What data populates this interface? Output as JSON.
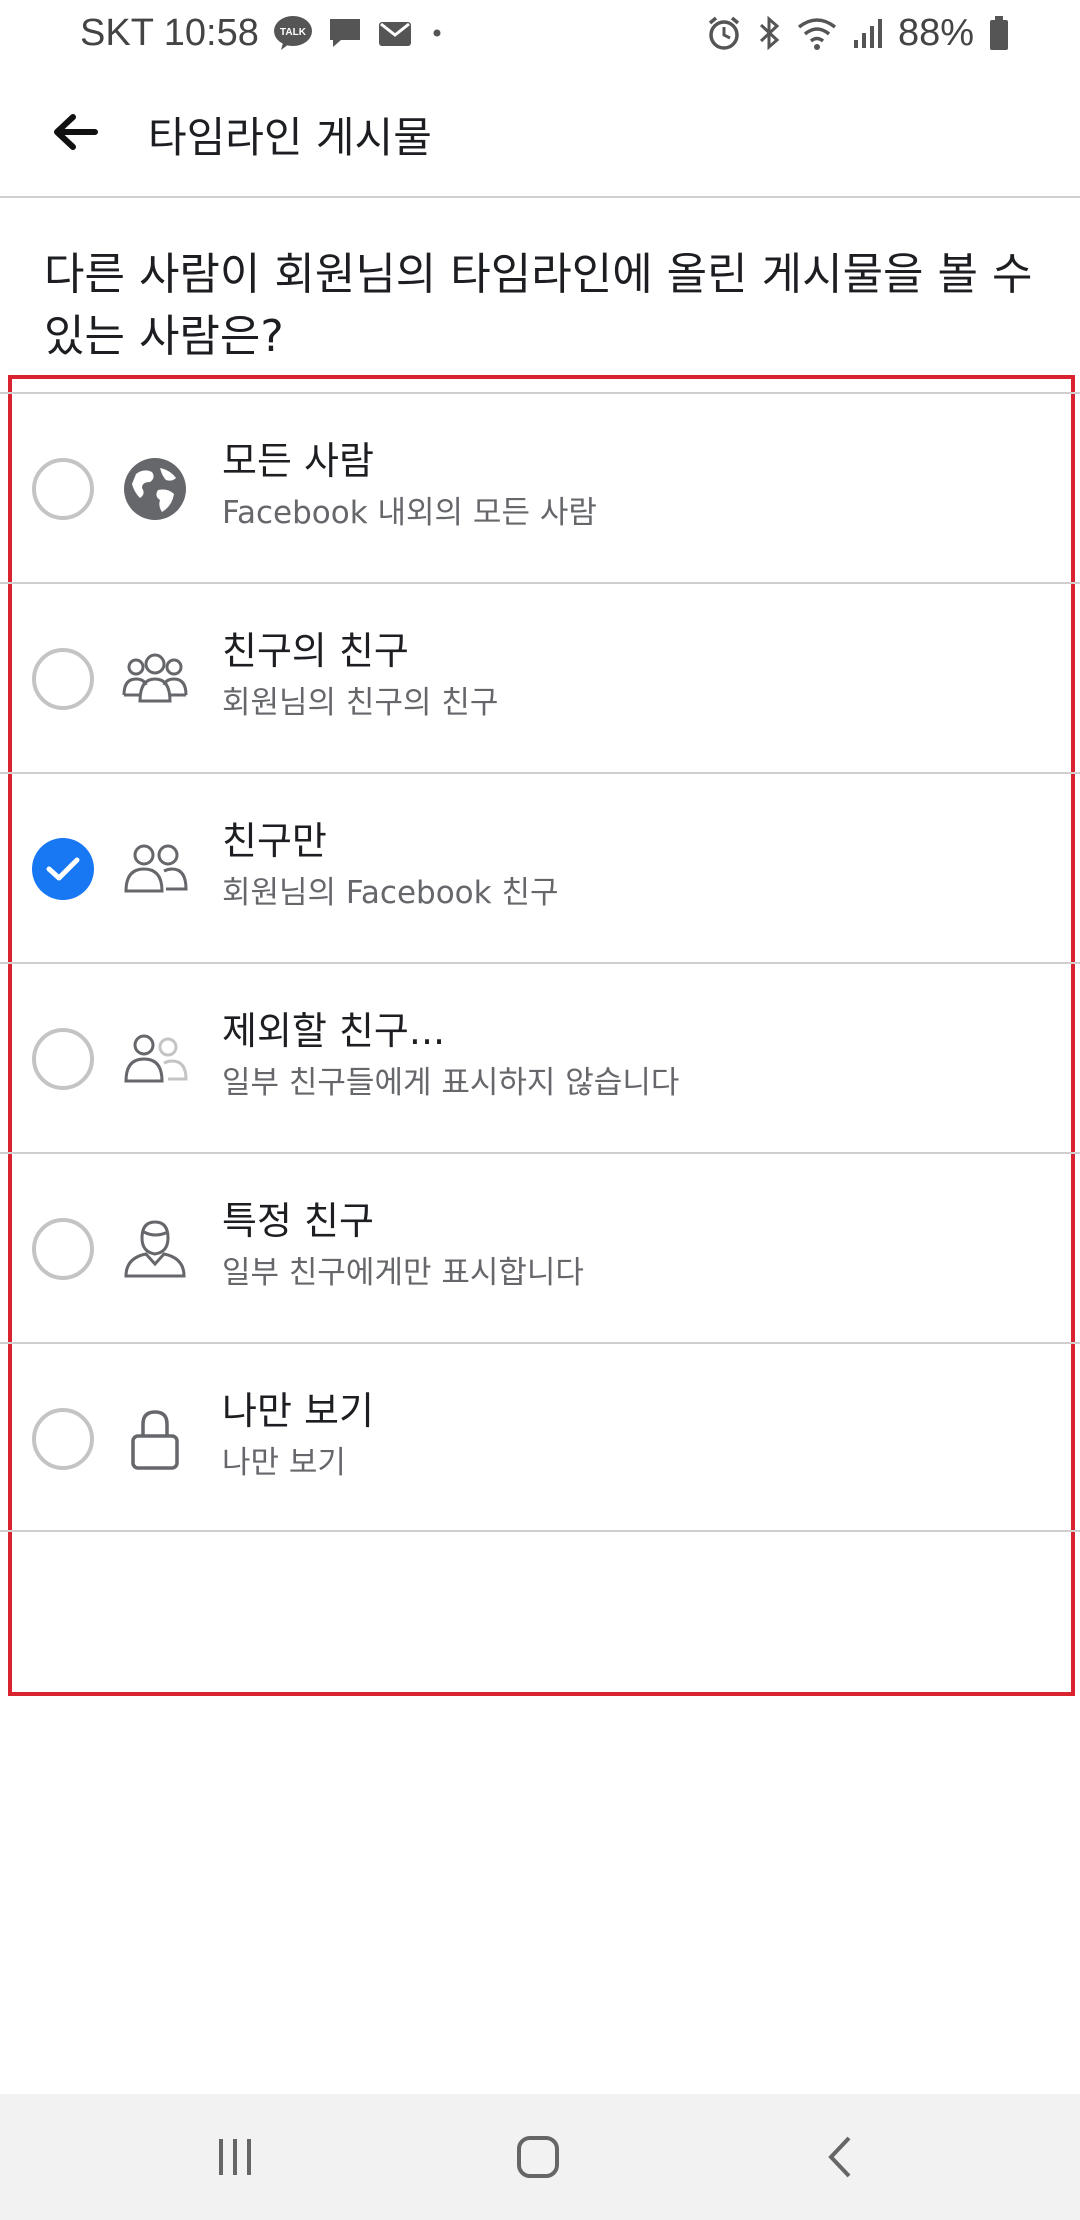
{
  "status_bar": {
    "carrier_time": "SKT 10:58",
    "battery": "88%",
    "talk_badge": "TALK",
    "icons": [
      "kakaotalk-icon",
      "message-icon",
      "mail-icon",
      "dot-icon",
      "alarm-icon",
      "bluetooth-icon",
      "wifi-icon",
      "signal-icon",
      "battery-icon"
    ]
  },
  "header": {
    "title": "타임라인 게시물",
    "back_icon": "back-arrow-icon"
  },
  "question": "다른 사람이 회원님의 타임라인에 올린 게시물을 볼 수 있는 사람은?",
  "options": [
    {
      "title": "모든 사람",
      "subtitle": "Facebook 내외의 모든 사람",
      "icon": "globe-icon",
      "selected": false
    },
    {
      "title": "친구의 친구",
      "subtitle": "회원님의 친구의 친구",
      "icon": "friends-of-friends-icon",
      "selected": false
    },
    {
      "title": "친구만",
      "subtitle": "회원님의 Facebook 친구",
      "icon": "friends-icon",
      "selected": true
    },
    {
      "title": "제외할 친구...",
      "subtitle": "일부 친구들에게 표시하지 않습니다",
      "icon": "friends-except-icon",
      "selected": false
    },
    {
      "title": "특정 친구",
      "subtitle": "일부 친구에게만 표시합니다",
      "icon": "specific-friend-icon",
      "selected": false
    },
    {
      "title": "나만 보기",
      "subtitle": "나만 보기",
      "icon": "lock-icon",
      "selected": false
    }
  ],
  "colors": {
    "accent": "#1877f2",
    "highlight": "#d9232e",
    "subtitle": "#65676b",
    "divider": "#cfcfcf"
  },
  "nav_bar": {
    "icons": [
      "recent-apps-icon",
      "home-icon",
      "back-icon"
    ]
  }
}
